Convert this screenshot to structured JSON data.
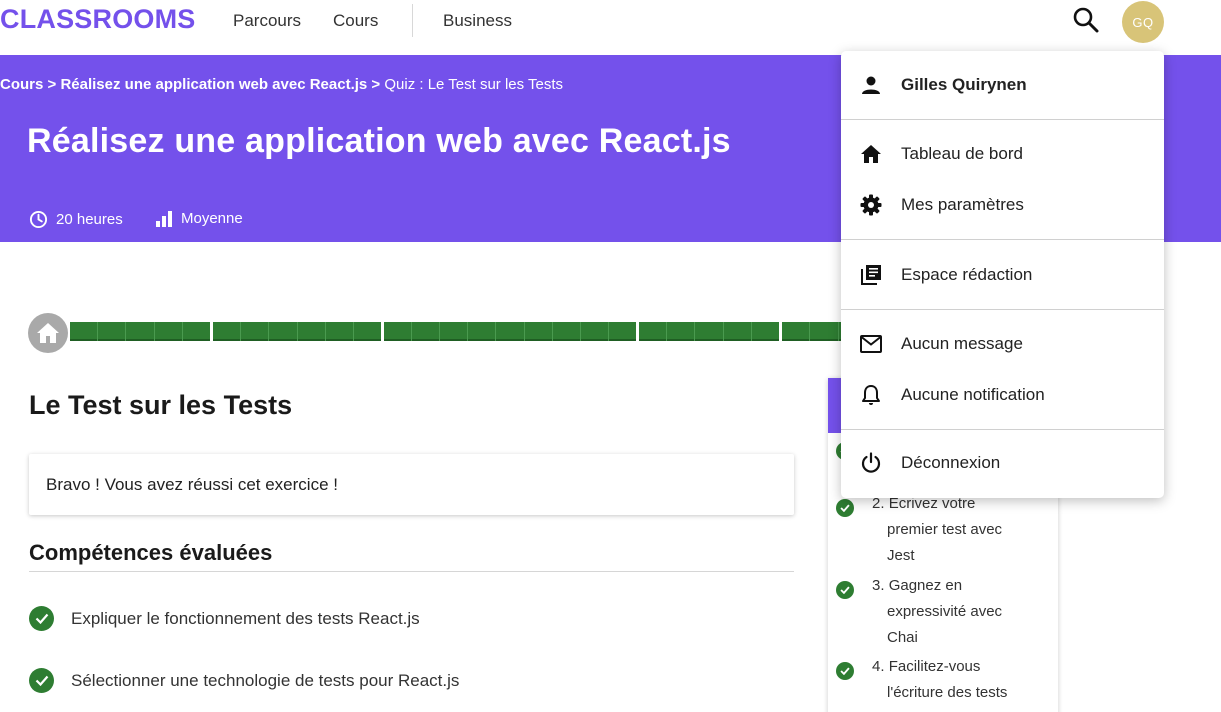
{
  "header": {
    "brand": "CLASSROOMS",
    "nav": [
      "Parcours",
      "Cours",
      "Business"
    ],
    "avatar_initials": "GQ"
  },
  "banner": {
    "breadcrumb": {
      "part1": "Cours",
      "part2": "Réalisez une application web avec React.js",
      "separator": ">",
      "current": "Quiz : Le Test sur les Tests"
    },
    "title": "Réalisez une application web avec React.js",
    "duration": "20 heures",
    "difficulty": "Moyenne"
  },
  "progress": {
    "segments": [
      5,
      6,
      9,
      5,
      3
    ],
    "color": "#2e7d32"
  },
  "quiz": {
    "title": "Le Test sur les Tests",
    "success_message": "Bravo ! Vous avez réussi cet exercice !",
    "skills_title": "Compétences évaluées",
    "skills": [
      "Expliquer le fonctionnement des tests React.js",
      "Sélectionner une technologie de tests pour React.js"
    ]
  },
  "outline": {
    "chapters": [
      {
        "number": "2.",
        "lines": [
          "Écrivez votre",
          "premier test avec",
          "Jest"
        ]
      },
      {
        "number": "3.",
        "lines": [
          "Gagnez en",
          "expressivité avec",
          "Chai"
        ]
      },
      {
        "number": "4.",
        "lines": [
          "Facilitez-vous",
          "l'écriture des tests"
        ]
      }
    ]
  },
  "menu": {
    "user_name": "Gilles Quirynen",
    "items": {
      "dashboard": "Tableau de bord",
      "settings": "Mes paramètres",
      "writing": "Espace rédaction",
      "messages": "Aucun message",
      "notifications": "Aucune notification",
      "logout": "Déconnexion"
    }
  },
  "colors": {
    "brand": "#7451eb",
    "success": "#2e7d32",
    "avatar": "#d8c478"
  }
}
